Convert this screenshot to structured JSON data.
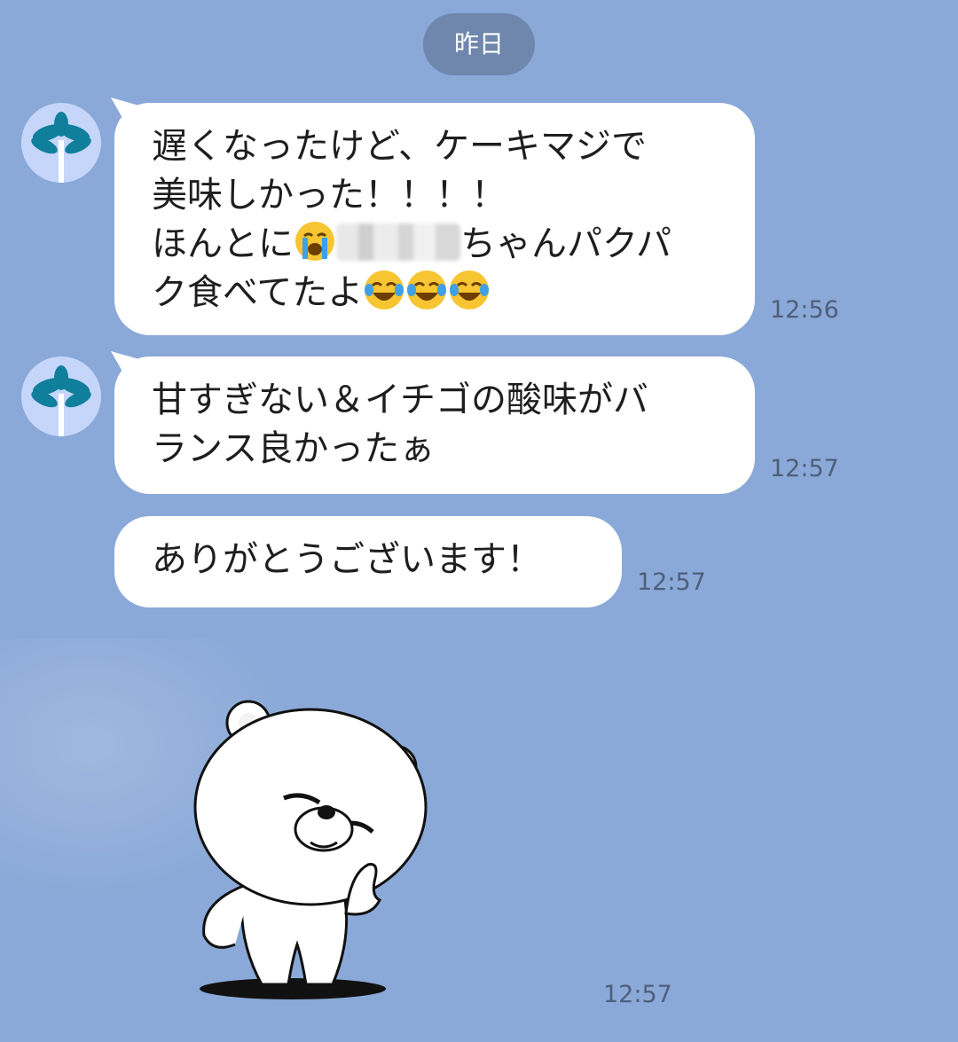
{
  "date_separator": "昨日",
  "messages": [
    {
      "lines": [
        "遅くなったけど、ケーキマジで",
        "美味しかった！！！！",
        [
          "ほんとに",
          "ちゃんパクパ"
        ],
        "ク食べてたよ"
      ],
      "time": "12:56"
    },
    {
      "lines": [
        "甘すぎない＆イチゴの酸味がバ",
        "ランス良かったぁ"
      ],
      "time": "12:57"
    },
    {
      "lines": [
        "ありがとうございます！"
      ],
      "time": "12:57"
    }
  ],
  "sticker": {
    "time": "12:57"
  },
  "colors": {
    "background": "#8aa9d8",
    "bubble": "#ffffff",
    "date_pill": "#6f87ad",
    "avatar_bg": "#c6d6fa",
    "palm": "#0f7f9c"
  }
}
